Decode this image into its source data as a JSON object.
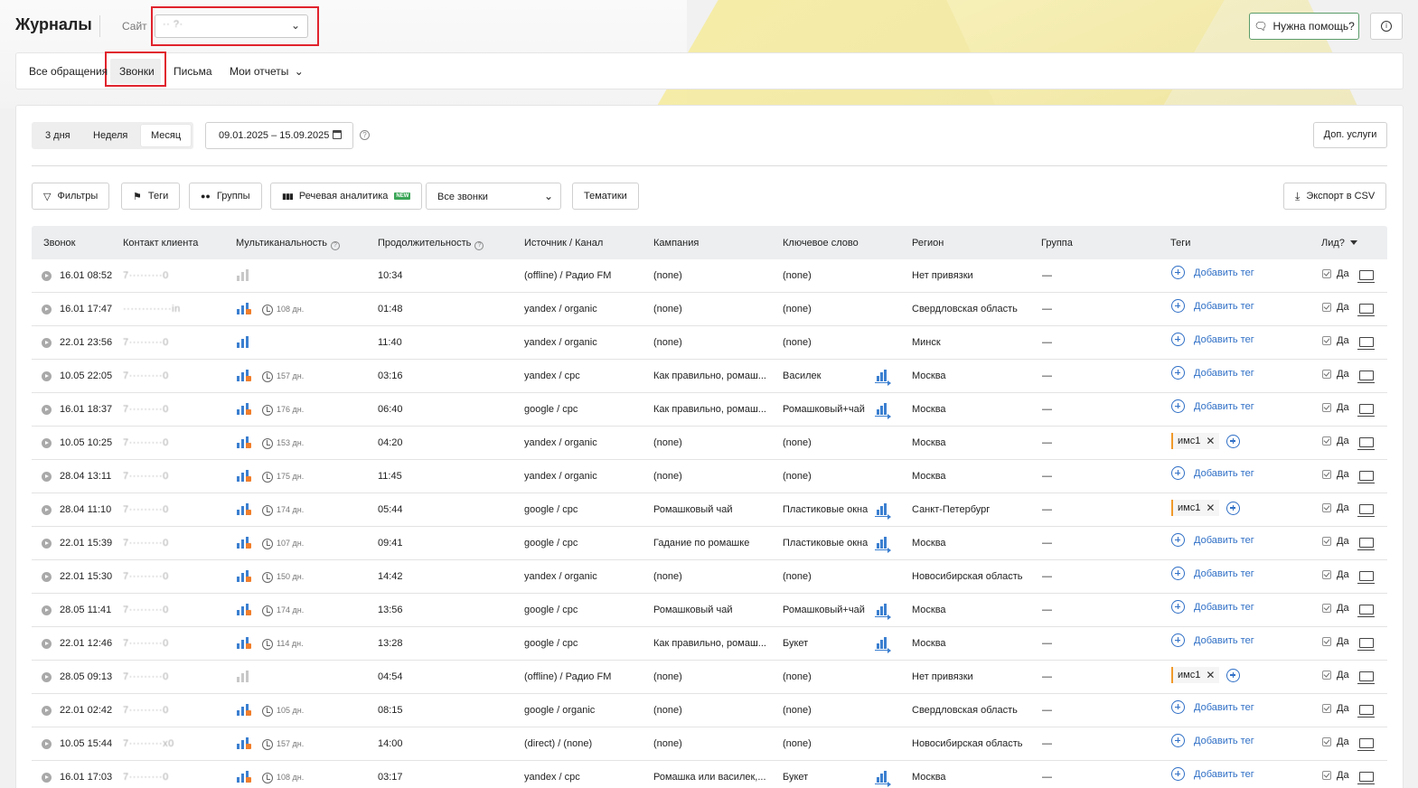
{
  "header": {
    "title": "Журналы",
    "site_label": "Сайт",
    "site_value": "·· ?·",
    "help_button": "Нужна помощь?",
    "info_button": "i"
  },
  "tabs": [
    {
      "label": "Все обращения"
    },
    {
      "label": "Звонки",
      "active": true
    },
    {
      "label": "Письма"
    },
    {
      "label": "Мои отчеты"
    }
  ],
  "period": {
    "options": [
      "3 дня",
      "Неделя",
      "Месяц"
    ],
    "selected": "Месяц",
    "date_range": "09.01.2025 – 15.09.2025",
    "help": "?",
    "extra_services": "Доп. услуги"
  },
  "toolbar": {
    "filters": "Фильтры",
    "tags": "Теги",
    "groups": "Группы",
    "speech": "Речевая аналитика",
    "new_badge": "NEW",
    "all_calls": "Все звонки",
    "topics": "Тематики",
    "export": "Экспорт в CSV"
  },
  "table": {
    "headers": {
      "call": "Звонок",
      "contact": "Контакт клиента",
      "multichannel": "Мультиканальность",
      "duration": "Продолжительность",
      "source": "Источник / Канал",
      "campaign": "Кампания",
      "keyword": "Ключевое слово",
      "region": "Регион",
      "group": "Группа",
      "tags": "Теги",
      "lead": "Лид?"
    },
    "add_tag_label": "Добавить тег",
    "lead_yes": "Да",
    "rows": [
      {
        "date": "16.01 08:52",
        "contact": "7·········0",
        "mc": "grey",
        "days": "",
        "duration": "10:34",
        "source": "(offline) / Радио FM",
        "campaign": "(none)",
        "keyword": "(none)",
        "kw_icon": false,
        "region": "Нет привязки",
        "group": "—",
        "tag": ""
      },
      {
        "date": "16.01 17:47",
        "contact": "·············in",
        "mc": "blue",
        "days": "108 дн.",
        "duration": "01:48",
        "source": "yandex / organic",
        "campaign": "(none)",
        "keyword": "(none)",
        "kw_icon": false,
        "region": "Свердловская область",
        "group": "—",
        "tag": ""
      },
      {
        "date": "22.01 23:56",
        "contact": "7·········0",
        "mc": "blue-plain",
        "days": "",
        "duration": "11:40",
        "source": "yandex / organic",
        "campaign": "(none)",
        "keyword": "(none)",
        "kw_icon": false,
        "region": "Минск",
        "group": "—",
        "tag": ""
      },
      {
        "date": "10.05 22:05",
        "contact": "7·········0",
        "mc": "blue",
        "days": "157 дн.",
        "duration": "03:16",
        "source": "yandex / cpc",
        "campaign": "Как правильно, ромаш...",
        "keyword": "Василек",
        "kw_icon": true,
        "region": "Москва",
        "group": "—",
        "tag": ""
      },
      {
        "date": "16.01 18:37",
        "contact": "7·········0",
        "mc": "blue",
        "days": "176 дн.",
        "duration": "06:40",
        "source": "google / cpc",
        "campaign": "Как правильно, ромаш...",
        "keyword": "Ромашковый+чай",
        "kw_icon": true,
        "region": "Москва",
        "group": "—",
        "tag": ""
      },
      {
        "date": "10.05 10:25",
        "contact": "7·········0",
        "mc": "blue",
        "days": "153 дн.",
        "duration": "04:20",
        "source": "yandex / organic",
        "campaign": "(none)",
        "keyword": "(none)",
        "kw_icon": false,
        "region": "Москва",
        "group": "—",
        "tag": "имс1"
      },
      {
        "date": "28.04 13:11",
        "contact": "7·········0",
        "mc": "blue",
        "days": "175 дн.",
        "duration": "11:45",
        "source": "yandex / organic",
        "campaign": "(none)",
        "keyword": "(none)",
        "kw_icon": false,
        "region": "Москва",
        "group": "—",
        "tag": ""
      },
      {
        "date": "28.04 11:10",
        "contact": "7·········0",
        "mc": "blue",
        "days": "174 дн.",
        "duration": "05:44",
        "source": "google / cpc",
        "campaign": "Ромашковый чай",
        "keyword": "Пластиковые окна",
        "kw_icon": true,
        "region": "Санкт-Петербург",
        "group": "—",
        "tag": "имс1"
      },
      {
        "date": "22.01 15:39",
        "contact": "7·········0",
        "mc": "blue",
        "days": "107 дн.",
        "duration": "09:41",
        "source": "google / cpc",
        "campaign": "Гадание по ромашке",
        "keyword": "Пластиковые окна",
        "kw_icon": true,
        "region": "Москва",
        "group": "—",
        "tag": ""
      },
      {
        "date": "22.01 15:30",
        "contact": "7·········0",
        "mc": "blue",
        "days": "150 дн.",
        "duration": "14:42",
        "source": "yandex / organic",
        "campaign": "(none)",
        "keyword": "(none)",
        "kw_icon": false,
        "region": "Новосибирская область",
        "group": "—",
        "tag": ""
      },
      {
        "date": "28.05 11:41",
        "contact": "7·········0",
        "mc": "blue",
        "days": "174 дн.",
        "duration": "13:56",
        "source": "google / cpc",
        "campaign": "Ромашковый чай",
        "keyword": "Ромашковый+чай",
        "kw_icon": true,
        "region": "Москва",
        "group": "—",
        "tag": ""
      },
      {
        "date": "22.01 12:46",
        "contact": "7·········0",
        "mc": "blue",
        "days": "114 дн.",
        "duration": "13:28",
        "source": "google / cpc",
        "campaign": "Как правильно, ромаш...",
        "keyword": "Букет",
        "kw_icon": true,
        "region": "Москва",
        "group": "—",
        "tag": ""
      },
      {
        "date": "28.05 09:13",
        "contact": "7·········0",
        "mc": "grey",
        "days": "",
        "duration": "04:54",
        "source": "(offline) / Радио FM",
        "campaign": "(none)",
        "keyword": "(none)",
        "kw_icon": false,
        "region": "Нет привязки",
        "group": "—",
        "tag": "имс1"
      },
      {
        "date": "22.01 02:42",
        "contact": "7·········0",
        "mc": "blue",
        "days": "105 дн.",
        "duration": "08:15",
        "source": "google / organic",
        "campaign": "(none)",
        "keyword": "(none)",
        "kw_icon": false,
        "region": "Свердловская область",
        "group": "—",
        "tag": ""
      },
      {
        "date": "10.05 15:44",
        "contact": "7·········x0",
        "mc": "blue",
        "days": "157 дн.",
        "duration": "14:00",
        "source": "(direct) / (none)",
        "campaign": "(none)",
        "keyword": "(none)",
        "kw_icon": false,
        "region": "Новосибирская область",
        "group": "—",
        "tag": ""
      },
      {
        "date": "16.01 17:03",
        "contact": "7·········0",
        "mc": "blue",
        "days": "108 дн.",
        "duration": "03:17",
        "source": "yandex / cpc",
        "campaign": "Ромашка или василек,...",
        "keyword": "Букет",
        "kw_icon": true,
        "region": "Москва",
        "group": "—",
        "tag": ""
      }
    ]
  },
  "colors": {
    "accent_red": "#e0232d",
    "link_blue": "#2f6fc6",
    "bars_blue": "#3b7fd0",
    "tag_orange": "#f09a2b",
    "help_green": "#5b9c6b"
  }
}
